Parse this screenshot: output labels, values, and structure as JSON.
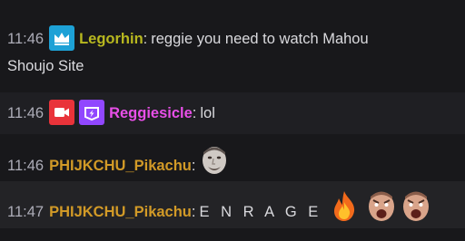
{
  "colors": {
    "background": "#18181b",
    "alt_row": "#1f1f23",
    "timestamp": "#adadb8",
    "text": "#dadade",
    "name_legorhin": "#b8b81f",
    "name_reggiesicle": "#e84fe8",
    "name_phijkchu": "#d29a27",
    "badge_crown": "#1da1d6",
    "badge_camera": "#e9333a",
    "badge_prime": "#9147ff"
  },
  "messages": [
    {
      "time": "11:46",
      "badges": [
        "crown-icon"
      ],
      "username": "Legorhin",
      "text": "reggie you need to watch Mahou",
      "text_cont": "Shoujo Site"
    },
    {
      "time": "11:46",
      "badges": [
        "camera-icon",
        "prime-gaming-icon"
      ],
      "username": "Reggiesicle",
      "text": "lol"
    },
    {
      "time": "11:46",
      "badges": [],
      "username": "PHIJKCHU_Pikachu",
      "emotes": [
        "kappa-face-emote"
      ]
    },
    {
      "time": "11:47",
      "badges": [],
      "username": "PHIJKCHU_Pikachu",
      "text": "E N R A G E",
      "emotes": [
        "fire-emote",
        "rage-face-emote",
        "rage-face-emote"
      ]
    }
  ],
  "separator": ":"
}
